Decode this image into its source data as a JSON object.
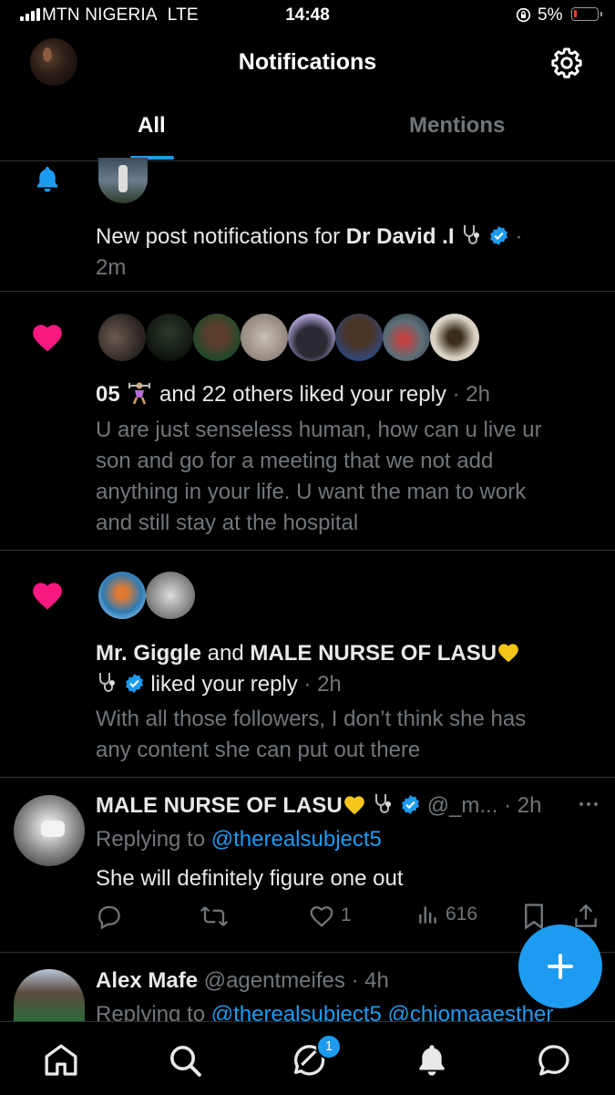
{
  "status_bar": {
    "carrier": "MTN NIGERIA",
    "network": "LTE",
    "time": "14:48",
    "battery": "5%"
  },
  "header": {
    "title": "Notifications"
  },
  "tabs": [
    {
      "label": "All",
      "active": true
    },
    {
      "label": "Mentions",
      "active": false
    }
  ],
  "notifications": [
    {
      "icon": "bell-icon",
      "prefix": "New post notifications for ",
      "name": "Dr David .I",
      "time": "2m"
    },
    {
      "icon": "heart-icon",
      "name": "05",
      "rest": " and 22 others liked your reply",
      "time": "2h",
      "body_lines": [
        "U are just senseless human, how can u live ur",
        "son and go for a meeting that we not add",
        "anything in your life. U want the man to work",
        "and still stay at the hospital"
      ]
    },
    {
      "icon": "heart-icon",
      "name1": "Mr. Giggle",
      "and": " and ",
      "name2": "MALE NURSE OF LASU",
      "rest": " liked your reply",
      "time": "2h",
      "body_lines": [
        "With all those followers, I don’t think she has",
        "any content she can put out there"
      ]
    }
  ],
  "reply_post": {
    "name": "MALE NURSE OF LASU",
    "handle": "@_m...",
    "time": "2h",
    "replying_label": "Replying to ",
    "replying_to": "@therealsubject5",
    "text": "She will definitely figure one out",
    "likes": "1",
    "views": "616"
  },
  "next_post": {
    "name": "Alex Mafe",
    "handle": "@agentmeifes",
    "time": "4h",
    "replying_label": "Replying to ",
    "replying_to": "@therealsubject5 @chiomaaesther"
  },
  "bottom_nav": {
    "messages_badge": "1"
  },
  "colors": {
    "accent": "#1d9bf0",
    "like": "#f91880",
    "background": "#000000",
    "muted": "#71767b"
  }
}
